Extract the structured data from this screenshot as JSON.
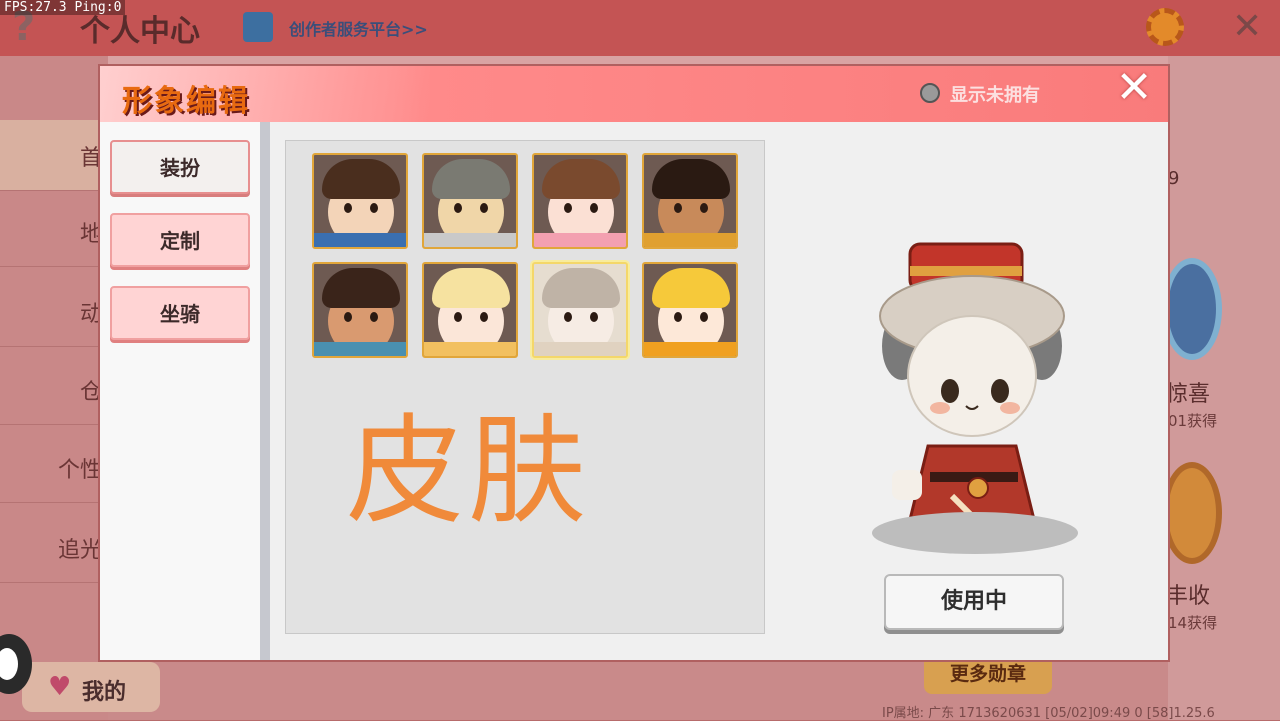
{
  "hud": {
    "fps": "FPS:27.3  Ping:0"
  },
  "background": {
    "title": "个人中心",
    "creator_link": "创作者服务平台>>",
    "sidebar_items": [
      "首",
      "地",
      "动",
      "仓",
      "个性",
      "追光"
    ],
    "mine_label": "我的",
    "right_texts": {
      "count_fragment": "9",
      "medal1_title": "惊喜",
      "medal1_sub": "01获得",
      "medal2_title": "丰收",
      "medal2_sub": "14获得"
    },
    "more_medals": "更多勋章",
    "footer": "IP属地: 广东   1713620631   [05/02]09:49 0   [58]1.25.6",
    "bottom_caption": "形象编辑"
  },
  "modal": {
    "title": "形象编辑",
    "toggle_label": "显示未拥有",
    "close_glyph": "✕",
    "tabs": [
      {
        "label": "装扮",
        "active": true
      },
      {
        "label": "定制",
        "active": false
      },
      {
        "label": "坐骑",
        "active": false
      }
    ],
    "section_label": "皮肤",
    "use_button": "使用中",
    "skins": [
      {
        "hair": "#4a2e1e",
        "face": "#f3d4b8",
        "accent": "#3a6fb0"
      },
      {
        "hair": "#7a7a72",
        "face": "#f0d6a8",
        "accent": "#c9c9c9"
      },
      {
        "hair": "#7a4a2e",
        "face": "#fbe0d4",
        "accent": "#f3a0b0"
      },
      {
        "hair": "#2a1a12",
        "face": "#c88a5a",
        "accent": "#e0a030"
      },
      {
        "hair": "#3a241a",
        "face": "#d99a70",
        "accent": "#4a90b0"
      },
      {
        "hair": "#f6e2a0",
        "face": "#fbe6d8",
        "accent": "#f2c060"
      },
      {
        "hair": "#bfb3a6",
        "face": "#f6ece4",
        "accent": "#e0d2c0",
        "selected": true
      },
      {
        "hair": "#f6c93a",
        "face": "#fde8d8",
        "accent": "#f0a020"
      }
    ]
  },
  "colors": {
    "accent_orange": "#f08a3a",
    "header_pink": "#f97b7b"
  }
}
